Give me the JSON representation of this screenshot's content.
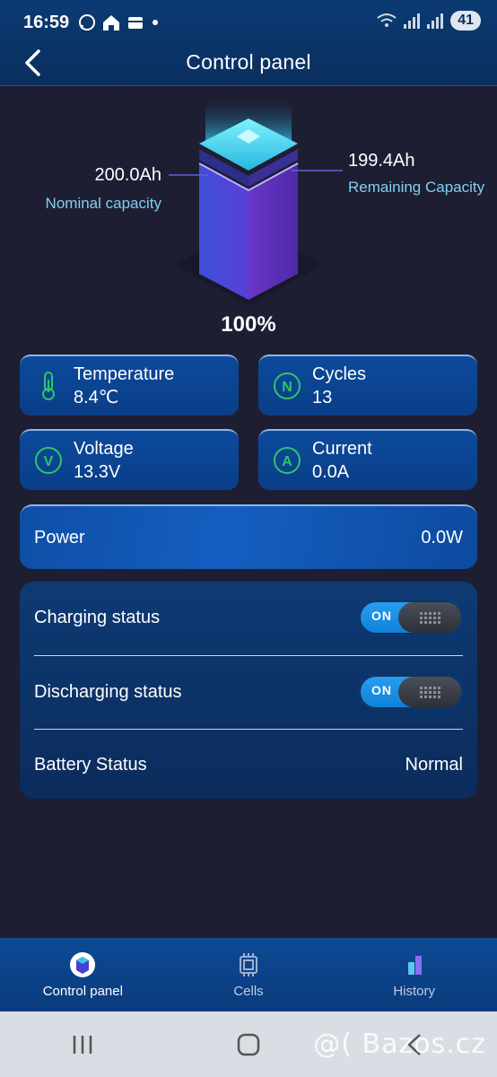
{
  "status_bar": {
    "time": "16:59",
    "battery_level": "41",
    "icons": [
      "whatsapp-icon",
      "home-icon",
      "wallet-icon",
      "dot-icon",
      "wifi-icon",
      "signal-icon"
    ]
  },
  "header": {
    "title": "Control panel"
  },
  "battery": {
    "nominal_value": "200.0Ah",
    "nominal_label": "Nominal capacity",
    "remaining_value": "199.4Ah",
    "remaining_label": "Remaining Capacity",
    "percent": "100%",
    "fill_fraction": 1.0
  },
  "cards": {
    "temperature": {
      "label": "Temperature",
      "value": "8.4℃"
    },
    "cycles": {
      "label": "Cycles",
      "value": "13",
      "icon_letter": "N"
    },
    "voltage": {
      "label": "Voltage",
      "value": "13.3V",
      "icon_letter": "V"
    },
    "current": {
      "label": "Current",
      "value": "0.0A",
      "icon_letter": "A"
    }
  },
  "power": {
    "label": "Power",
    "value": "0.0W"
  },
  "status": {
    "charging": {
      "label": "Charging status",
      "toggle": "ON"
    },
    "discharging": {
      "label": "Discharging status",
      "toggle": "ON"
    },
    "battery": {
      "label": "Battery Status",
      "value": "Normal"
    }
  },
  "nav": {
    "items": [
      {
        "label": "Control panel",
        "active": true
      },
      {
        "label": "Cells",
        "active": false
      },
      {
        "label": "History",
        "active": false
      }
    ]
  },
  "watermark": "@( Bazos.cz",
  "colors": {
    "background": "#1d1e32",
    "accent": "#0c4a9c",
    "label_cyan": "#7fd0f2",
    "icon_green": "#2fc46a"
  }
}
